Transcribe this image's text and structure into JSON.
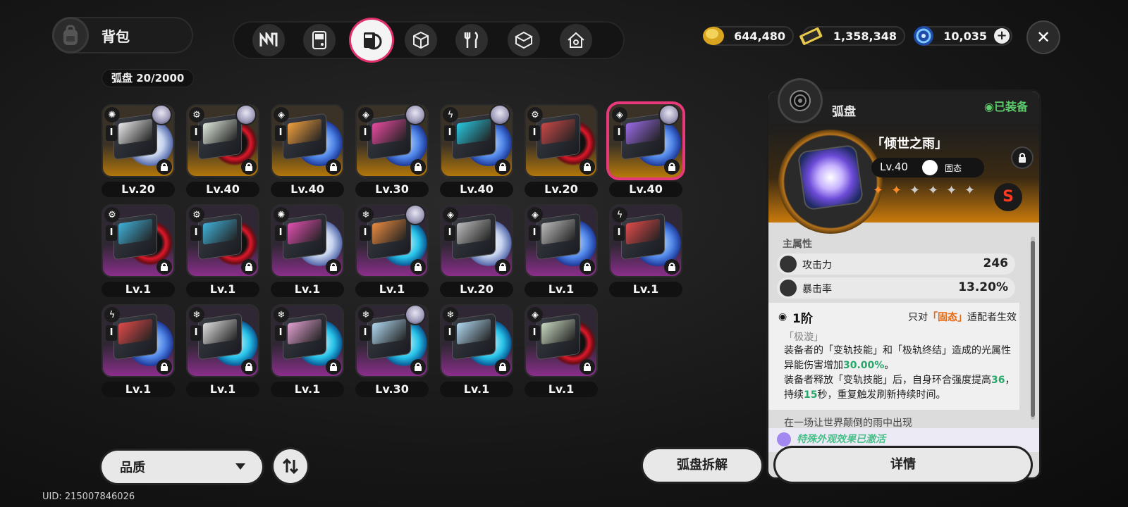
{
  "header": {
    "title": "背包",
    "bag_icon": "backpack-icon"
  },
  "tabs": [
    {
      "icon": "n-logo-icon",
      "active": false
    },
    {
      "icon": "gameboy-icon",
      "active": false
    },
    {
      "icon": "disc-tab-icon",
      "active": true
    },
    {
      "icon": "cube-icon",
      "active": false
    },
    {
      "icon": "fork-knife-icon",
      "active": false
    },
    {
      "icon": "gift-box-icon",
      "active": false
    },
    {
      "icon": "home-icon",
      "active": false
    }
  ],
  "currencies": [
    {
      "icon": "gold-coin-icon",
      "value": "644,480",
      "color": "#e0b020"
    },
    {
      "icon": "ticket-icon",
      "value": "1,358,348",
      "color": "#e8c84a"
    },
    {
      "icon": "polychrome-icon",
      "value": "10,035",
      "color": "#2f7ce8"
    }
  ],
  "add_label": "+",
  "close_label": "✕",
  "inventory": {
    "count_label": "弧盘",
    "count": "20/2000"
  },
  "discs": [
    {
      "lv": "Lv.20",
      "bg": "gold",
      "ring": "white",
      "attr": "✺",
      "avatar": true,
      "art": "#e8e8e8"
    },
    {
      "lv": "Lv.40",
      "bg": "gold",
      "ring": "red",
      "attr": "⚙",
      "avatar": true,
      "art": "#dfe8dc"
    },
    {
      "lv": "Lv.40",
      "bg": "gold",
      "ring": "blue",
      "attr": "◈",
      "avatar": false,
      "art": "#f0a040"
    },
    {
      "lv": "Lv.30",
      "bg": "gold",
      "ring": "blue",
      "attr": "◈",
      "avatar": true,
      "art": "#e84aa0"
    },
    {
      "lv": "Lv.40",
      "bg": "gold",
      "ring": "blue",
      "attr": "ϟ",
      "avatar": true,
      "art": "#28c8e0"
    },
    {
      "lv": "Lv.20",
      "bg": "gold",
      "ring": "red",
      "attr": "⚙",
      "avatar": false,
      "art": "#c84848"
    },
    {
      "lv": "Lv.40",
      "bg": "gold",
      "ring": "blue",
      "attr": "◈",
      "avatar": true,
      "art": "#9a6ae8",
      "selected": true
    },
    {
      "lv": "Lv.1",
      "bg": "purple",
      "ring": "red",
      "attr": "⚙",
      "avatar": false,
      "art": "#40b0d8"
    },
    {
      "lv": "Lv.1",
      "bg": "purple",
      "ring": "red",
      "attr": "⚙",
      "avatar": false,
      "art": "#40b0d8"
    },
    {
      "lv": "Lv.1",
      "bg": "purple",
      "ring": "white",
      "attr": "✺",
      "avatar": false,
      "art": "#e050b0"
    },
    {
      "lv": "Lv.1",
      "bg": "purple",
      "ring": "cyan",
      "attr": "❄",
      "avatar": true,
      "art": "#e88a40"
    },
    {
      "lv": "Lv.20",
      "bg": "purple",
      "ring": "white",
      "attr": "◈",
      "avatar": false,
      "art": "#bbbbbb"
    },
    {
      "lv": "Lv.1",
      "bg": "purple",
      "ring": "blue",
      "attr": "◈",
      "avatar": false,
      "art": "#bbbbbb"
    },
    {
      "lv": "Lv.1",
      "bg": "purple",
      "ring": "blue",
      "attr": "ϟ",
      "avatar": false,
      "art": "#e04a4a"
    },
    {
      "lv": "Lv.1",
      "bg": "purple",
      "ring": "blue",
      "attr": "ϟ",
      "avatar": false,
      "art": "#e04a4a"
    },
    {
      "lv": "Lv.1",
      "bg": "purple",
      "ring": "cyan",
      "attr": "❄",
      "avatar": false,
      "art": "#dddddd"
    },
    {
      "lv": "Lv.1",
      "bg": "purple",
      "ring": "cyan",
      "attr": "❄",
      "avatar": false,
      "art": "#e0a0d0"
    },
    {
      "lv": "Lv.30",
      "bg": "purple",
      "ring": "cyan",
      "attr": "❄",
      "avatar": true,
      "art": "#b0d8f0"
    },
    {
      "lv": "Lv.1",
      "bg": "purple",
      "ring": "cyan",
      "attr": "❄",
      "avatar": false,
      "art": "#b0d8f0"
    },
    {
      "lv": "Lv.1",
      "bg": "purple",
      "ring": "red",
      "attr": "◈",
      "avatar": false,
      "art": "#c8d8c0"
    }
  ],
  "controls": {
    "sort_label": "品质",
    "dismantle_label": "弧盘拆解",
    "details_label": "详情",
    "uid": "UID: 215007846026"
  },
  "detail": {
    "panel_title": "弧盘",
    "equipped": "◉已装备",
    "name": "「倾世之雨」",
    "level": "Lv.40",
    "type": "固态",
    "stars_total": 6,
    "stars_filled": 2,
    "rank": "S",
    "main_attr_title": "主属性",
    "stats": [
      {
        "name": "攻击力",
        "value": "246",
        "icon": "attack-icon"
      },
      {
        "name": "暴击率",
        "value": "13.20%",
        "icon": "crit-icon"
      }
    ],
    "set_tier": "1阶",
    "set_cond_prefix": "只对",
    "set_cond_hl": "「固态」",
    "set_cond_suffix": "适配者生效",
    "set_name": "「极漩」",
    "desc_p1a": "装备者的「变轨技能」和「极轨终结」造成的光属性异能伤害增加",
    "desc_p1b": "30.00%",
    "desc_p1c": "。",
    "desc_p2a": "装备者释放「变轨技能」后，自身环合强度提高",
    "desc_p2b": "36",
    "desc_p2c": "，持续",
    "desc_p2d": "15",
    "desc_p2e": "秒，重复触发刷新持续时间。",
    "lore": "在一场让世界颠倒的雨中出现",
    "special": "特殊外观效果已激活"
  }
}
